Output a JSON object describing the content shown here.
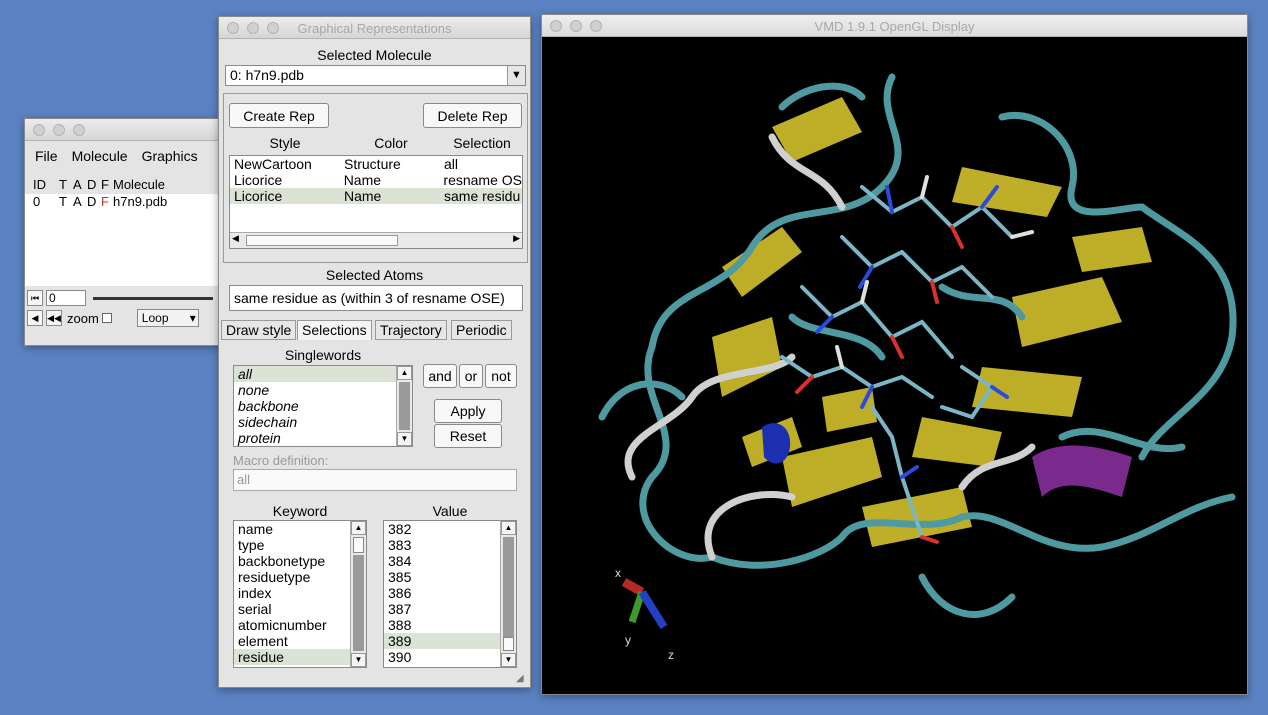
{
  "main_window": {
    "menu": [
      "File",
      "Molecule",
      "Graphics"
    ],
    "columns": [
      "ID",
      "T",
      "A",
      "D",
      "F",
      "Molecule"
    ],
    "rows": [
      {
        "id": "0",
        "t": "T",
        "a": "A",
        "d": "D",
        "f": "F",
        "molecule": "h7n9.pdb"
      }
    ],
    "frame_value": "0",
    "zoom_label": "zoom",
    "loop_value": "Loop"
  },
  "reps_window": {
    "title": "Graphical Representations",
    "selected_molecule_label": "Selected Molecule",
    "selected_molecule_value": "0: h7n9.pdb",
    "create_rep": "Create Rep",
    "delete_rep": "Delete Rep",
    "rep_columns": [
      "Style",
      "Color",
      "Selection"
    ],
    "reps": [
      {
        "style": "NewCartoon",
        "color": "Structure",
        "selection": "all"
      },
      {
        "style": "Licorice",
        "color": "Name",
        "selection": "resname OS"
      },
      {
        "style": "Licorice",
        "color": "Name",
        "selection": "same residu"
      }
    ],
    "selected_atoms_label": "Selected Atoms",
    "selected_atoms_value": "same residue as (within 3 of resname OSE)",
    "tabs": [
      "Draw style",
      "Selections",
      "Trajectory",
      "Periodic"
    ],
    "singlewords_label": "Singlewords",
    "singlewords": [
      "all",
      "none",
      "backbone",
      "sidechain",
      "protein"
    ],
    "op_and": "and",
    "op_or": "or",
    "op_not": "not",
    "apply": "Apply",
    "reset": "Reset",
    "macro_label": "Macro definition:",
    "macro_value": "all",
    "keyword_label": "Keyword",
    "value_label": "Value",
    "keywords": [
      "name",
      "type",
      "backbonetype",
      "residuetype",
      "index",
      "serial",
      "atomicnumber",
      "element",
      "residue"
    ],
    "values": [
      "382",
      "383",
      "384",
      "385",
      "386",
      "387",
      "388",
      "389",
      "390"
    ]
  },
  "gl_window": {
    "title": "VMD 1.9.1 OpenGL Display",
    "axis_x": "x",
    "axis_y": "y",
    "axis_z": "z"
  },
  "colors": {
    "desktop": "#5b82c2",
    "cartoon_sheet": "#c9b82a",
    "cartoon_coil": "#4f9aa0",
    "helix_purple": "#7a2a8c",
    "helix_blue": "#1c2fb0"
  }
}
